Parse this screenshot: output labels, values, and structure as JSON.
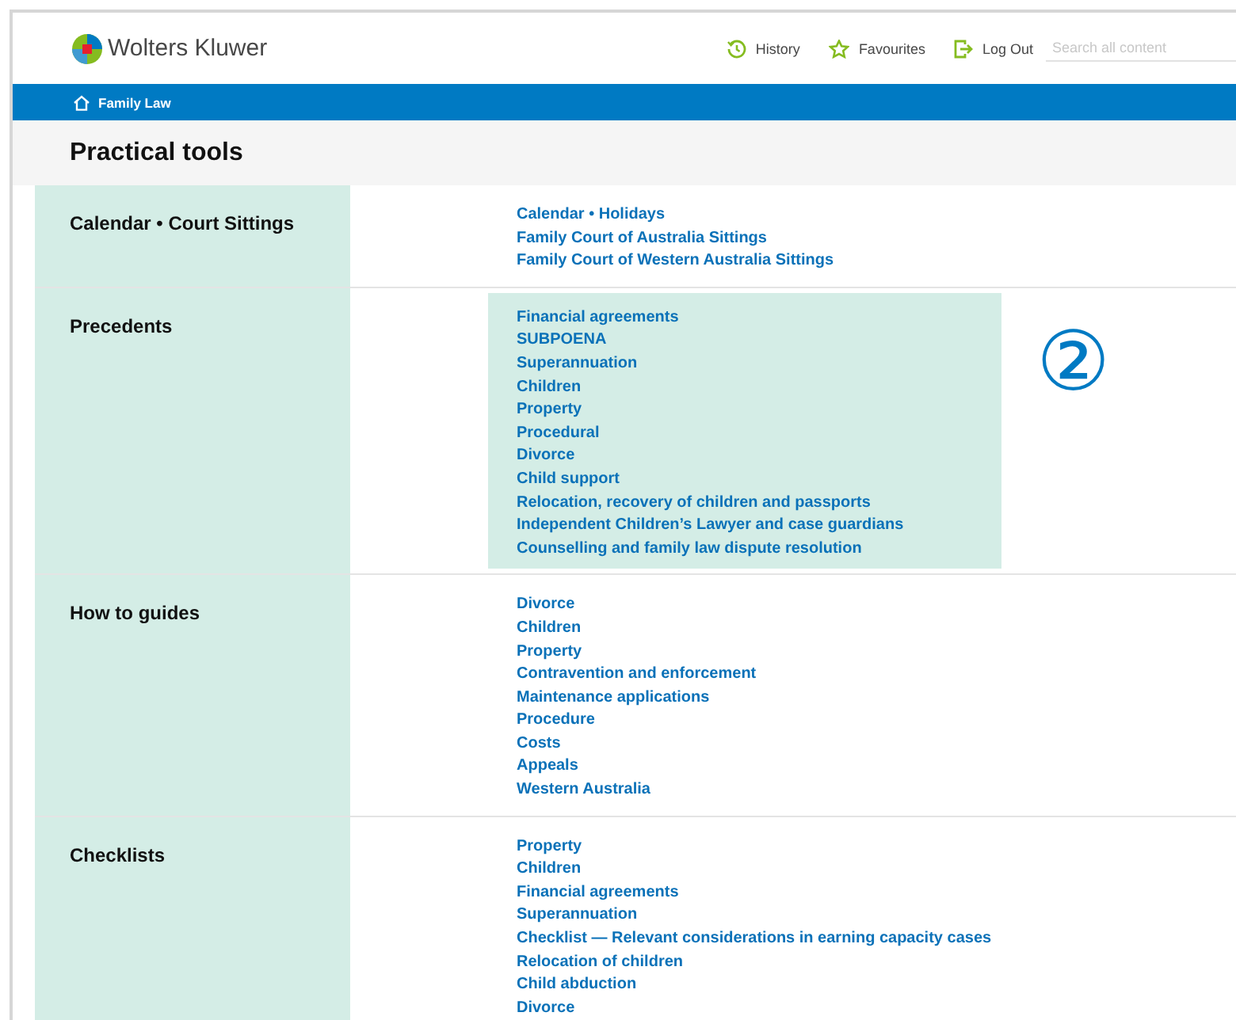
{
  "header": {
    "logo": "Wolters Kluwer",
    "nav": [
      {
        "kind": "history",
        "label": "History"
      },
      {
        "kind": "favourites",
        "label": "Favourites"
      },
      {
        "kind": "logout",
        "label": "Log Out"
      }
    ],
    "search": {
      "placeholder": "Search all content"
    }
  },
  "breadcrumb": {
    "label": "Family Law"
  },
  "page_title": "Practical tools",
  "sections": [
    {
      "title": "Calendar • Court Sittings",
      "highlighted": false,
      "links": [
        "Calendar • Holidays",
        "Family Court of Australia Sittings",
        "Family Court of Western Australia Sittings"
      ]
    },
    {
      "title": "Precedents",
      "highlighted": true,
      "callout": "②",
      "links": [
        "Financial agreements",
        "SUBPOENA",
        "Superannuation",
        "Children",
        "Property",
        "Procedural",
        "Divorce",
        "Child support",
        "Relocation, recovery of children and passports",
        "Independent Children’s Lawyer and case guardians",
        "Counselling and family law dispute resolution"
      ]
    },
    {
      "title": "How to guides",
      "highlighted": false,
      "links": [
        "Divorce",
        "Children",
        "Property",
        "Contravention and enforcement",
        "Maintenance applications",
        "Procedure",
        "Costs",
        "Appeals",
        "Western Australia"
      ]
    },
    {
      "title": "Checklists",
      "highlighted": false,
      "links": [
        "Property",
        "Children",
        "Financial agreements",
        "Superannuation",
        "Checklist — Relevant considerations in earning capacity cases",
        "Relocation of children",
        "Child abduction",
        "Divorce"
      ]
    }
  ]
}
